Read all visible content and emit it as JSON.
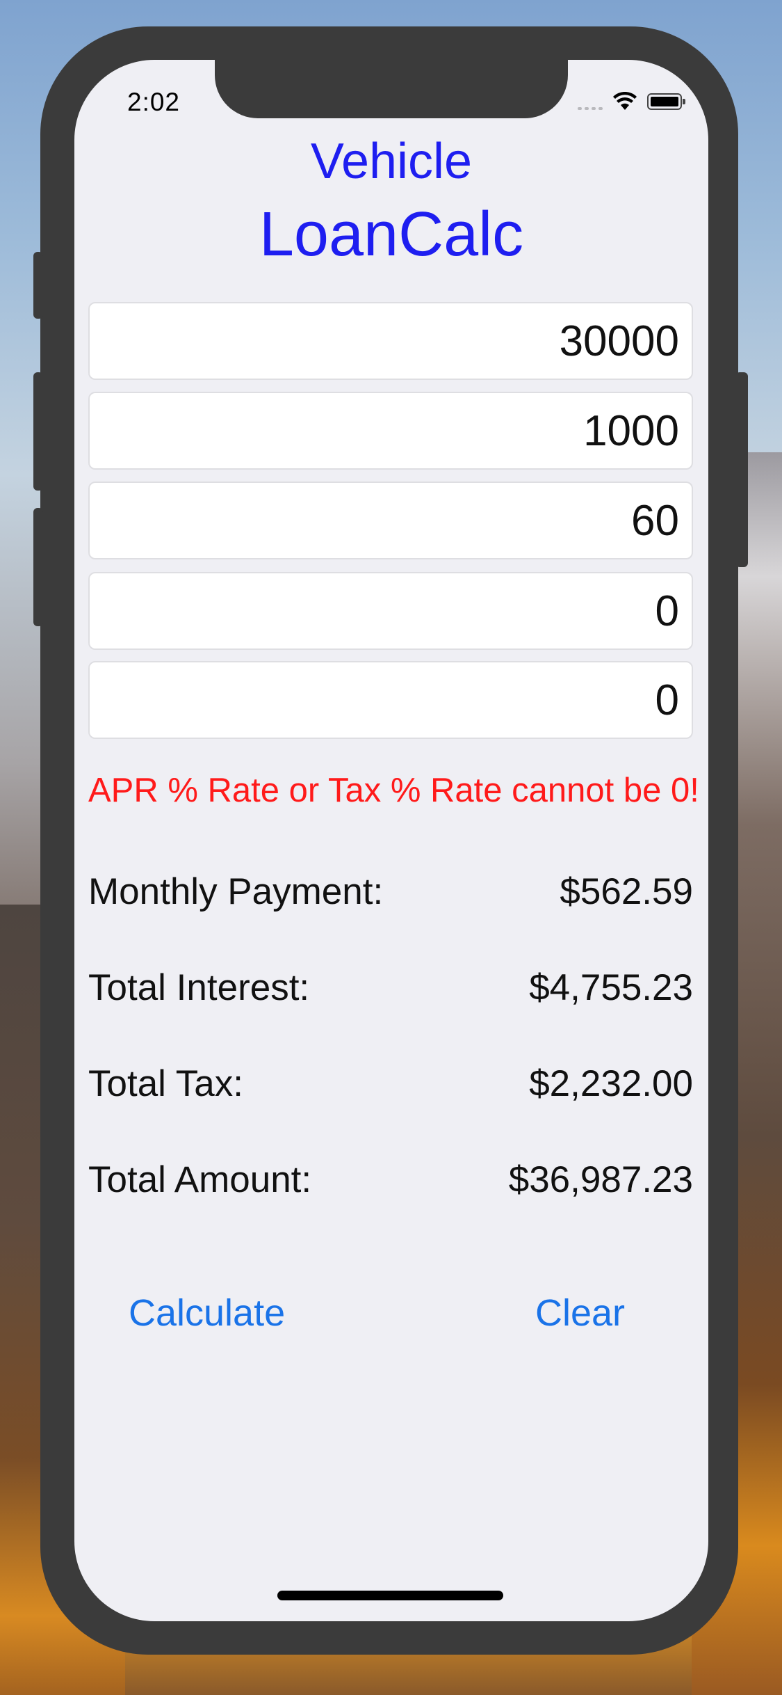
{
  "status_bar": {
    "time": "2:02"
  },
  "app": {
    "title_line1": "Vehicle",
    "title_line2": "LoanCalc"
  },
  "inputs": [
    {
      "value": "30000"
    },
    {
      "value": "1000"
    },
    {
      "value": "60"
    },
    {
      "value": "0"
    },
    {
      "value": "0"
    }
  ],
  "error_message": "APR % Rate or Tax % Rate cannot be 0!",
  "results": {
    "monthly_payment": {
      "label": "Monthly Payment:",
      "value": "$562.59"
    },
    "total_interest": {
      "label": "Total Interest:",
      "value": "$4,755.23"
    },
    "total_tax": {
      "label": "Total Tax:",
      "value": "$2,232.00"
    },
    "total_amount": {
      "label": "Total Amount:",
      "value": "$36,987.23"
    }
  },
  "actions": {
    "calculate_label": "Calculate",
    "clear_label": "Clear"
  },
  "colors": {
    "title": "#1e1ef0",
    "error": "#ff1a1a",
    "link": "#1a73e8",
    "screen_bg": "#efeff4"
  },
  "icons": [
    "wifi-icon",
    "battery-icon",
    "cellular-signal-icon"
  ]
}
